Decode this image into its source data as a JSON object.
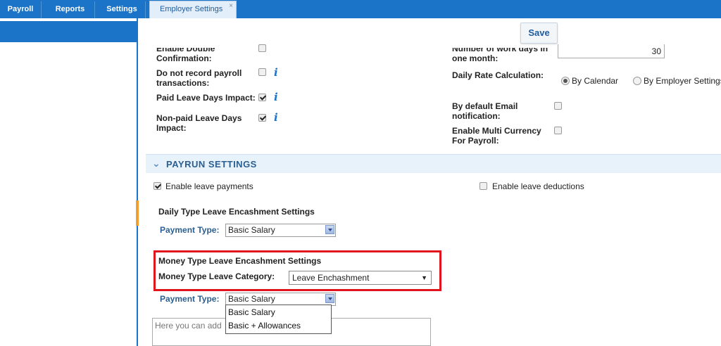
{
  "tabs": [
    {
      "label": "Payroll"
    },
    {
      "label": "Reports"
    },
    {
      "label": "Settings"
    },
    {
      "label": "Employer Settings",
      "close": "×"
    }
  ],
  "toolbar": {
    "save_label": "Save"
  },
  "left_settings": {
    "enable_double_confirmation": {
      "label": "Enable Double\nConfirmation:",
      "checked": false
    },
    "do_not_record": {
      "label": "Do not record payroll\ntransactions:",
      "checked": false,
      "info": "i"
    },
    "paid_leave_days_impact": {
      "label": "Paid Leave Days Impact:",
      "checked": true,
      "info": "i"
    },
    "non_paid_leave_days_impact": {
      "label": "Non-paid Leave Days\nImpact:",
      "checked": true,
      "info": "i"
    }
  },
  "right_settings": {
    "work_days": {
      "label": "Number of work days in\none month:",
      "value": "30"
    },
    "daily_rate": {
      "label": "Daily Rate Calculation:",
      "options": [
        "By Calendar",
        "By Employer Settings"
      ],
      "selected": "By Calendar"
    },
    "email_notification": {
      "label": "By default Email\nnotification:",
      "checked": false
    },
    "multi_currency": {
      "label": "Enable Multi Currency\nFor Payroll:",
      "checked": false
    }
  },
  "payrun": {
    "section_title": "PAYRUN SETTINGS",
    "enable_leave_payments": {
      "label": "Enable leave payments",
      "checked": true
    },
    "enable_leave_deductions": {
      "label": "Enable leave deductions",
      "checked": false
    },
    "daily_type_title": "Daily Type Leave Encashment Settings",
    "daily_payment_type": {
      "label": "Payment Type:",
      "value": "Basic Salary"
    },
    "money_type_title": "Money Type Leave Encashment Settings",
    "money_type_category": {
      "label": "Money Type Leave Category:",
      "value": "Leave Enchashment"
    },
    "money_payment_type": {
      "label": "Payment Type:",
      "value": "Basic Salary"
    },
    "payment_type_options": [
      "Basic Salary",
      "Basic + Allowances"
    ],
    "notes_placeholder": "Here you can add"
  },
  "colors": {
    "accent": "#1b74c7",
    "highlight": "#e0141c",
    "section_bg": "#e8f2fb"
  }
}
